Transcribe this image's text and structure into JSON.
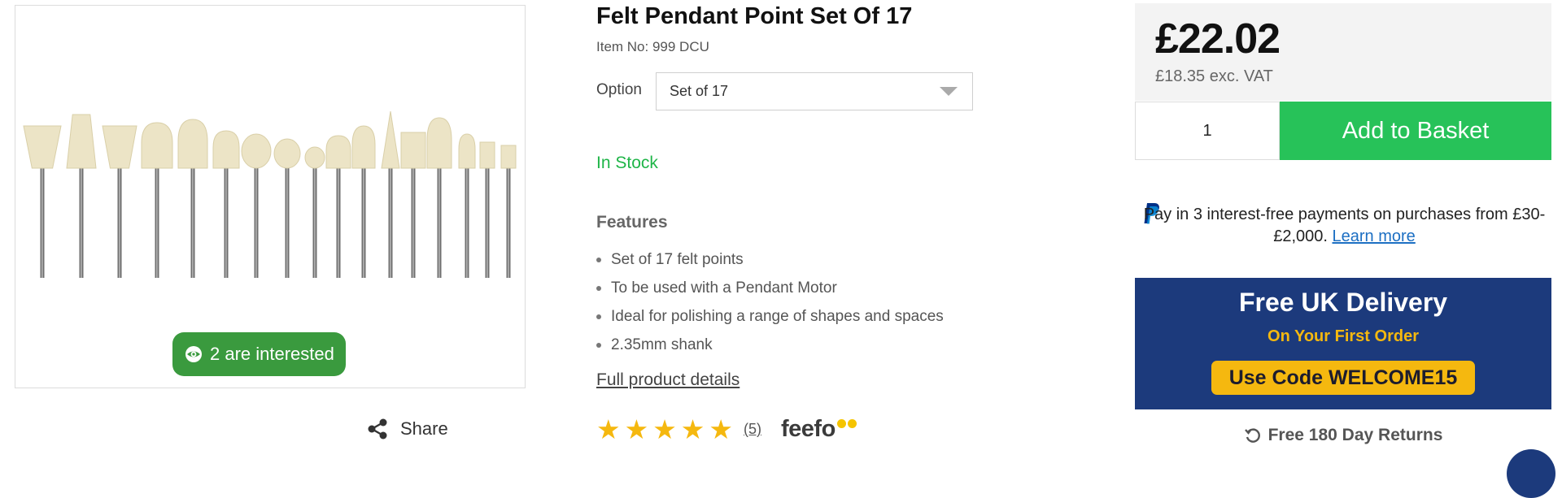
{
  "product": {
    "title": "Felt Pendant Point Set Of 17",
    "item_no": "Item No: 999 DCU",
    "option_label": "Option",
    "option_selected": "Set of 17",
    "stock_status": "In Stock",
    "features_title": "Features",
    "features": [
      "Set of 17 felt points",
      "To be used with a Pendant Motor",
      "Ideal for polishing a range of shapes and spaces",
      "2.35mm shank"
    ],
    "full_details_link": "Full product details",
    "rating_stars": 5,
    "review_count": "(5)",
    "review_provider": "feefo"
  },
  "gallery": {
    "interest_badge": "2 are interested",
    "share_label": "Share"
  },
  "purchase": {
    "price": "£22.02",
    "price_ex_vat": "£18.35 exc. VAT",
    "quantity": "1",
    "add_to_basket": "Add to Basket",
    "paypal_text": "Pay in 3 interest-free payments on purchases from £30-£2,000.",
    "paypal_link": "Learn more"
  },
  "promo": {
    "title": "Free UK Delivery",
    "subtitle": "On Your First Order",
    "code": "Use Code WELCOME15"
  },
  "returns": "Free 180 Day Returns",
  "colors": {
    "accent_green": "#27c259",
    "stock_green": "#1fb548",
    "promo_blue": "#1c3a7c",
    "promo_yellow": "#f5b80f",
    "badge_green": "#3a9a3e"
  }
}
